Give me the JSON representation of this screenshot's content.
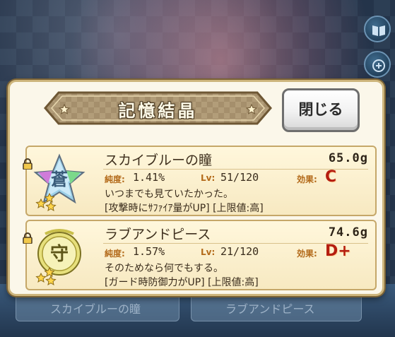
{
  "dialog": {
    "title": "記憶結晶",
    "close_label": "閉じる"
  },
  "items": [
    {
      "name": "スカイブルーの瞳",
      "weight": "65.0g",
      "purity_label": "純度:",
      "purity": "1.41%",
      "level_label": "Lv:",
      "level": "51/120",
      "effect_label": "効果:",
      "effect_grade": "C",
      "description": "いつまでも見ていたかった。",
      "ability": "[攻撃時にｻﾌｧｲｱ量がUP] [上限値:高]",
      "emblem_char": "蒼",
      "emblem_color": "#8fd3ff",
      "stars": 3
    },
    {
      "name": "ラブアンドピース",
      "weight": "74.6g",
      "purity_label": "純度:",
      "purity": "1.57%",
      "level_label": "Lv:",
      "level": "21/120",
      "effect_label": "効果:",
      "effect_grade": "D+",
      "description": "そのためなら何でもする。",
      "ability": "[ガード時防御力がUP] [上限値:高]",
      "emblem_char": "守",
      "emblem_color": "#e9e36a",
      "stars": 3
    }
  ],
  "background_cards": [
    {
      "label": "スカイブルーの瞳"
    },
    {
      "label": "ラブアンドピース"
    }
  ],
  "side_buttons": [
    "book-icon",
    "menu-icon"
  ]
}
